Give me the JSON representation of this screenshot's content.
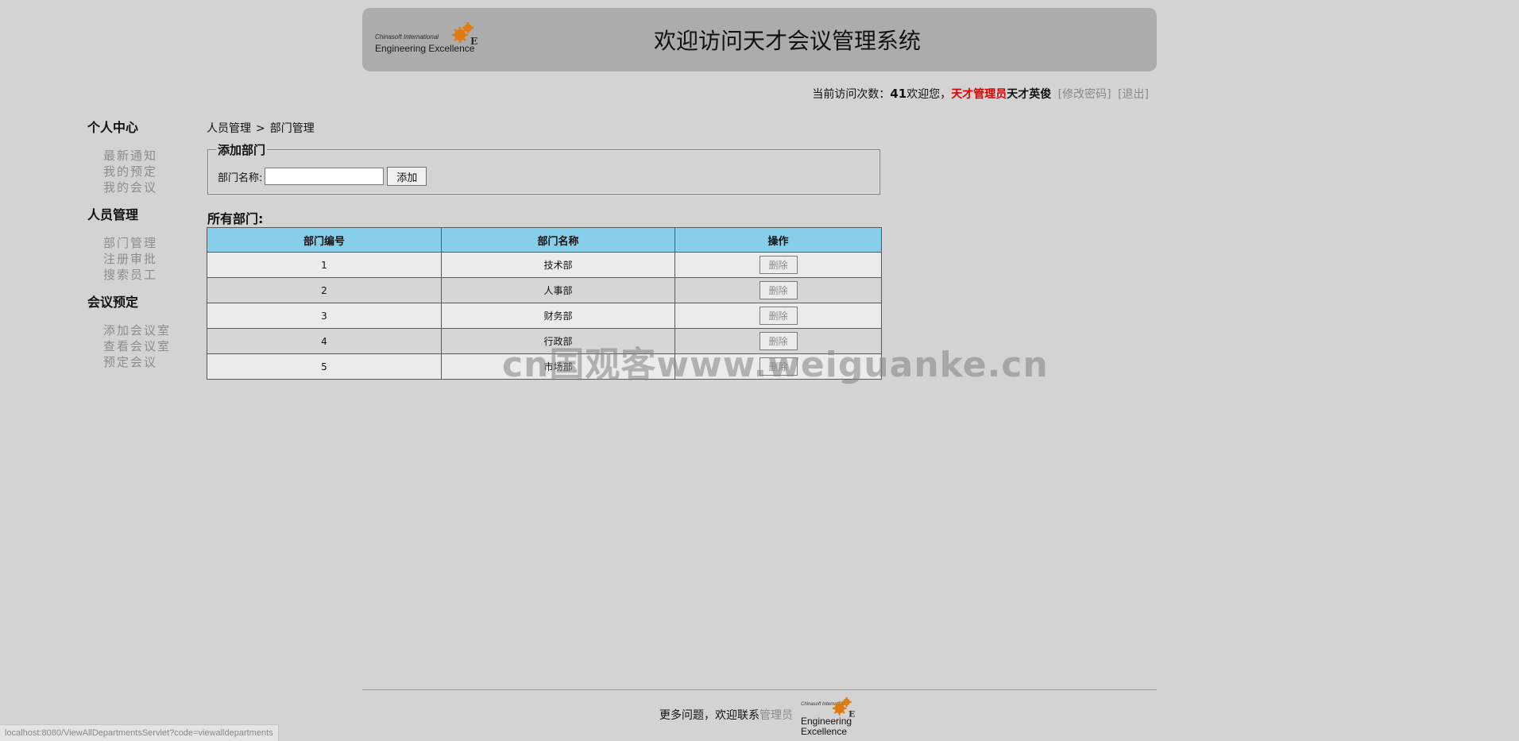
{
  "header": {
    "logo_small": "Chinasoft International",
    "logo_big": "Engineering Excellence",
    "title": "欢迎访问天才会议管理系统"
  },
  "userbar": {
    "visit_label": "当前访问次数：",
    "visit_count": "41",
    "welcome": "欢迎您，",
    "role": "天才管理员",
    "username": "天才英俊",
    "change_password": "[修改密码]",
    "logout": "[退出]"
  },
  "sidebar": {
    "groups": [
      {
        "title": "个人中心",
        "items": [
          "最新通知",
          "我的预定",
          "我的会议"
        ]
      },
      {
        "title": "人员管理",
        "items": [
          "部门管理",
          "注册审批",
          "搜索员工"
        ]
      },
      {
        "title": "会议预定",
        "items": [
          "添加会议室",
          "查看会议室",
          "预定会议"
        ]
      }
    ]
  },
  "breadcrumb": {
    "parent": "人员管理",
    "separator": ">",
    "current": "部门管理"
  },
  "add_form": {
    "legend": "添加部门",
    "label": "部门名称:",
    "value": "",
    "placeholder": "",
    "button": "添加"
  },
  "list": {
    "title": "所有部门:",
    "headers": [
      "部门编号",
      "部门名称",
      "操作"
    ],
    "delete_label": "删除",
    "rows": [
      {
        "id": "1",
        "name": "技术部"
      },
      {
        "id": "2",
        "name": "人事部"
      },
      {
        "id": "3",
        "name": "财务部"
      },
      {
        "id": "4",
        "name": "行政部"
      },
      {
        "id": "5",
        "name": "市场部"
      }
    ]
  },
  "watermark": "cn国观客www.weiguanke.cn",
  "footer": {
    "text": "更多问题，欢迎联系",
    "admin_link": "管理员",
    "logo_small": "Chinasoft International",
    "logo_big": "Engineering Excellence"
  },
  "statusbar": {
    "url": "localhost:8080/ViewAllDepartmentsServlet?code=viewalldepartments"
  },
  "colors": {
    "page_bg": "#d3d3d3",
    "banner_bg": "#acacac",
    "table_header": "#87ceeb",
    "role_red": "#e10000"
  }
}
